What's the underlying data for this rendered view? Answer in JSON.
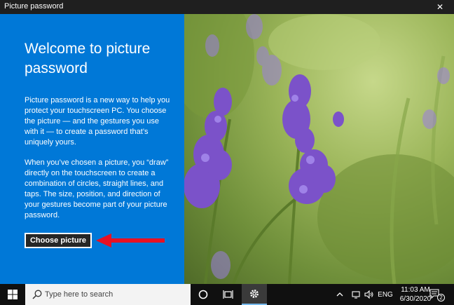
{
  "window": {
    "title": "Picture password",
    "close_glyph": "✕"
  },
  "left_panel": {
    "heading": "Welcome to picture password",
    "paragraph1": "Picture password is a new way to help you protect your touchscreen PC. You choose the picture — and the gestures you use with it — to create a password that’s uniquely yours.",
    "paragraph2": "When you’ve chosen a picture, you “draw” directly on the touchscreen to create a combination of circles, straight lines, and taps. The size, position, and direction of your gestures become part of your picture password.",
    "choose_button": "Choose picture"
  },
  "taskbar": {
    "search_placeholder": "Type here to search",
    "language": "ENG",
    "time": "11:03 AM",
    "date": "6/30/2020",
    "notification_count": "2"
  },
  "colors": {
    "accent": "#0078d7",
    "arrow": "#e81123"
  }
}
